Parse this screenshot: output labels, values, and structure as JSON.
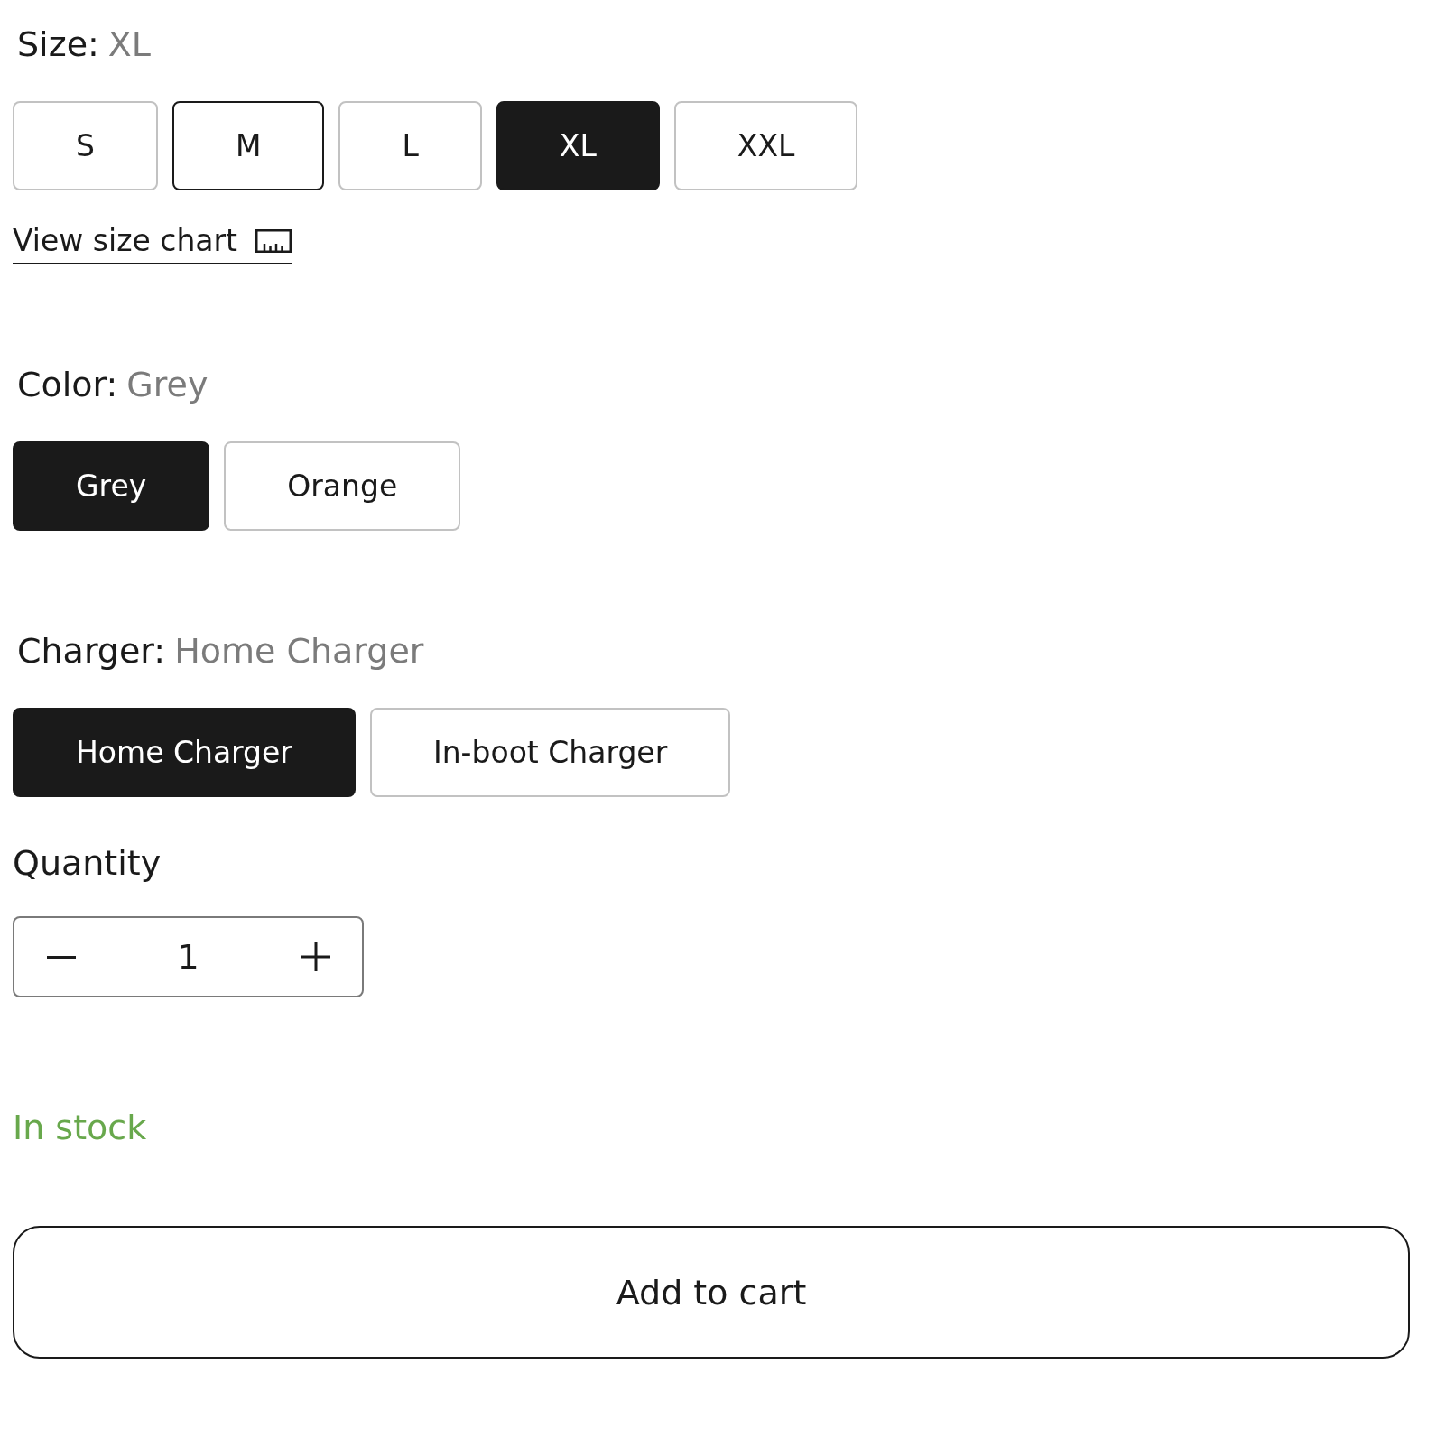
{
  "options": [
    {
      "label": "Size:",
      "value": "XL",
      "choices": [
        {
          "label": "S",
          "selected": false,
          "hovered": false
        },
        {
          "label": "M",
          "selected": false,
          "hovered": true
        },
        {
          "label": "L",
          "selected": false,
          "hovered": false
        },
        {
          "label": "XL",
          "selected": true,
          "hovered": false
        },
        {
          "label": "XXL",
          "selected": false,
          "hovered": false
        }
      ],
      "link": {
        "text": "View size chart"
      }
    },
    {
      "label": "Color:",
      "value": "Grey",
      "choices": [
        {
          "label": "Grey",
          "selected": true,
          "hovered": false
        },
        {
          "label": "Orange",
          "selected": false,
          "hovered": false
        }
      ]
    },
    {
      "label": "Charger:",
      "value": "Home Charger",
      "choices": [
        {
          "label": "Home Charger",
          "selected": true,
          "hovered": false
        },
        {
          "label": "In-boot Charger",
          "selected": false,
          "hovered": false
        }
      ]
    }
  ],
  "quantity": {
    "label": "Quantity",
    "value": "1"
  },
  "stock": {
    "text": "In stock",
    "in_stock": true
  },
  "add_to_cart": {
    "label": "Add to cart"
  }
}
